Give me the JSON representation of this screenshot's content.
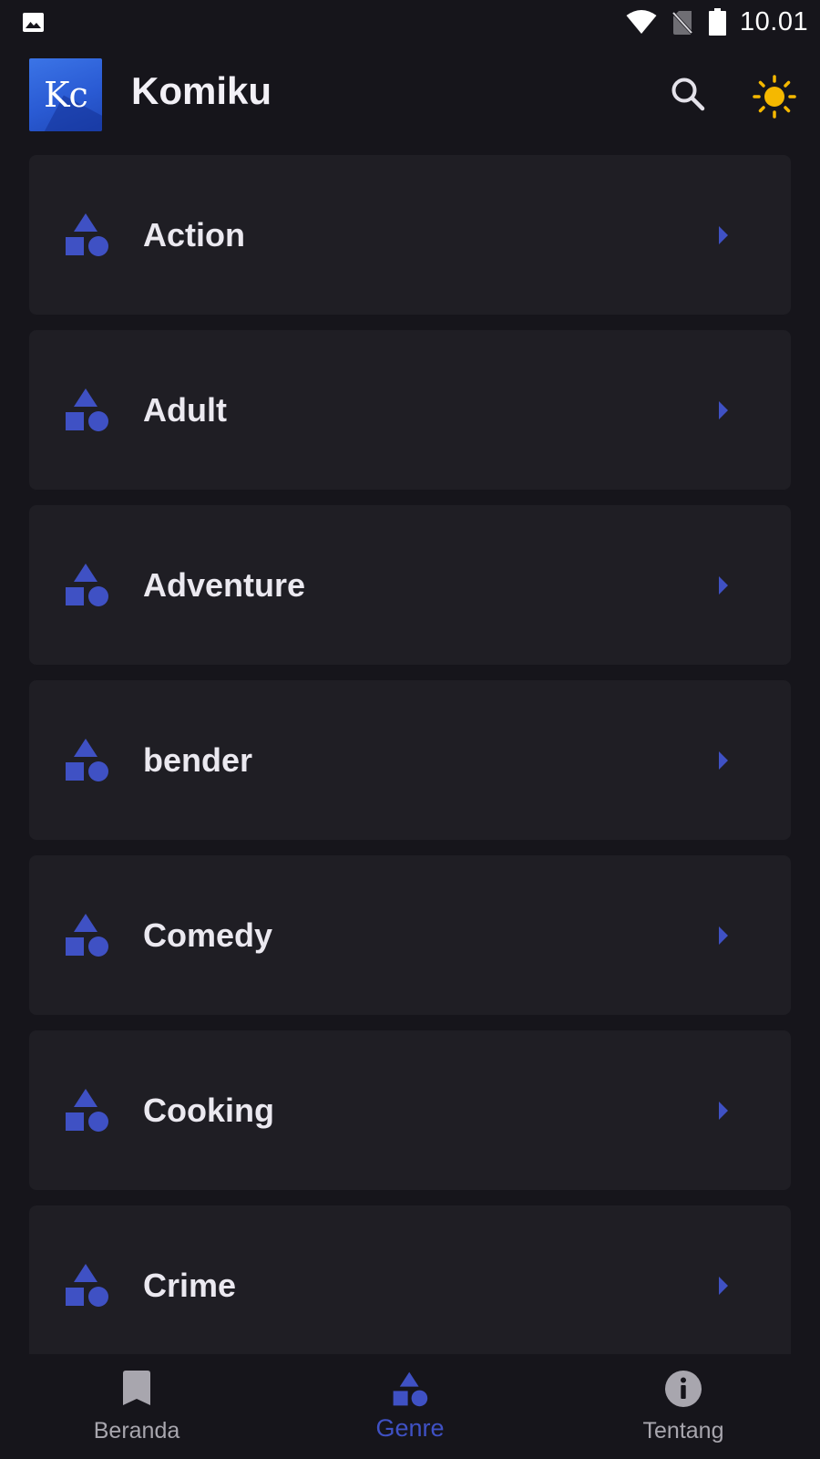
{
  "status_bar": {
    "time": "10.01",
    "icons": [
      "image-icon",
      "wifi-icon",
      "no-sim-icon",
      "battery-icon"
    ]
  },
  "app_bar": {
    "logo_text": "Kc",
    "title": "Komiku",
    "actions": [
      "search-icon",
      "sun-icon"
    ]
  },
  "genres": [
    {
      "label": "Action"
    },
    {
      "label": "Adult"
    },
    {
      "label": "Adventure"
    },
    {
      "label": "bender"
    },
    {
      "label": "Comedy"
    },
    {
      "label": "Cooking"
    },
    {
      "label": "Crime"
    }
  ],
  "bottom_nav": {
    "items": [
      {
        "label": "Beranda",
        "icon": "bookmark-icon",
        "active": false
      },
      {
        "label": "Genre",
        "icon": "shapes-icon",
        "active": true
      },
      {
        "label": "Tentang",
        "icon": "info-icon",
        "active": false
      }
    ]
  },
  "colors": {
    "background": "#16151b",
    "card": "#1f1e24",
    "accent": "#3f51c4",
    "sun": "#f5b800",
    "logo": "#2a5bd4"
  }
}
